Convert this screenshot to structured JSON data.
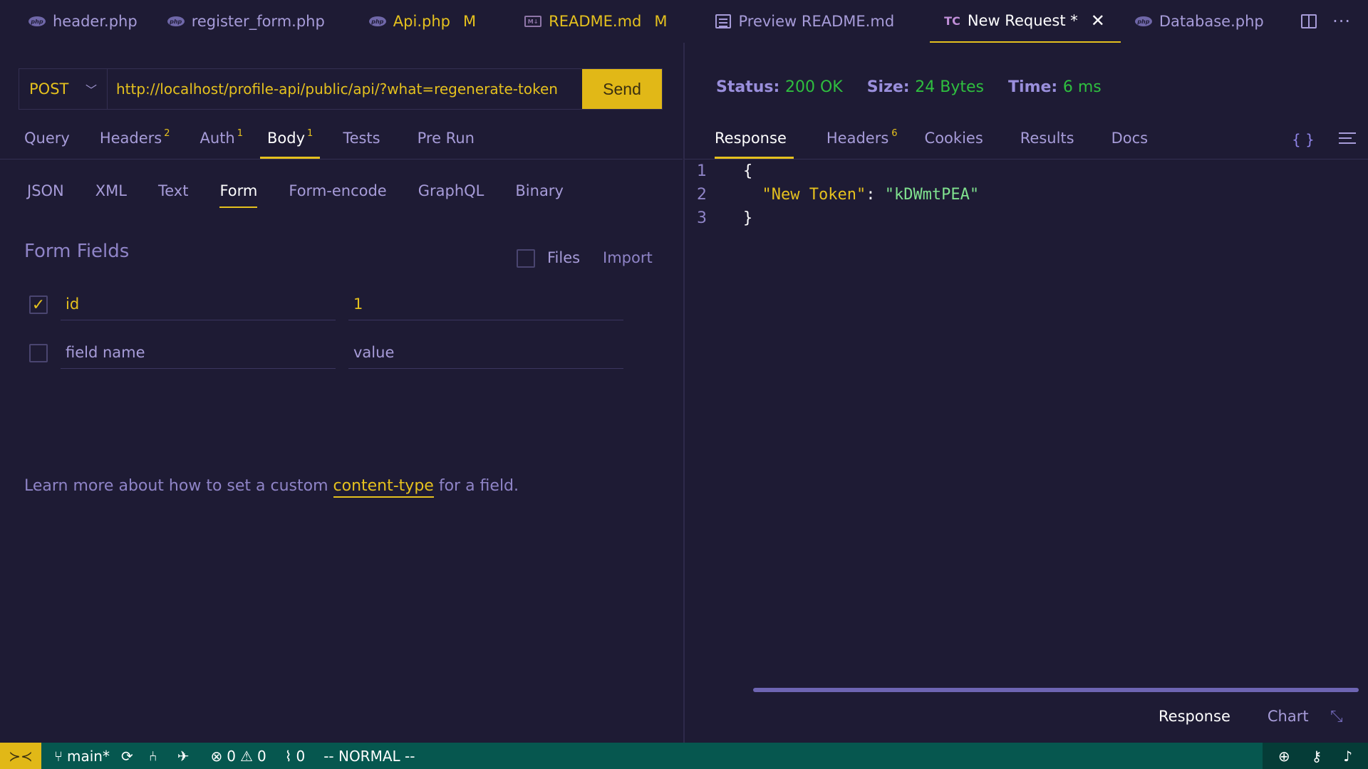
{
  "tabs": [
    {
      "label": "header.php",
      "icon": "php-file-icon",
      "modified": ""
    },
    {
      "label": "register_form.php",
      "icon": "php-file-icon",
      "modified": ""
    },
    {
      "label": "Api.php",
      "icon": "php-file-icon",
      "modified": "M"
    },
    {
      "label": "README.md",
      "icon": "markdown-file-icon",
      "modified": "M"
    },
    {
      "label": "Preview README.md",
      "icon": "preview-icon",
      "modified": ""
    },
    {
      "label": "New Request *",
      "icon": "thunder-client-icon",
      "icon_text": "TC",
      "modified": "",
      "active": true
    },
    {
      "label": "Database.php",
      "icon": "php-file-icon",
      "modified": ""
    }
  ],
  "request": {
    "method": "POST",
    "url": "http://localhost/profile-api/public/api/?what=regenerate-token",
    "send_label": "Send",
    "tabs": [
      {
        "label": "Query",
        "badge": ""
      },
      {
        "label": "Headers",
        "badge": "2"
      },
      {
        "label": "Auth",
        "badge": "1"
      },
      {
        "label": "Body",
        "badge": "1"
      },
      {
        "label": "Tests",
        "badge": ""
      },
      {
        "label": "Pre Run",
        "badge": ""
      }
    ],
    "body_tabs": [
      "JSON",
      "XML",
      "Text",
      "Form",
      "Form-encode",
      "GraphQL",
      "Binary"
    ],
    "form": {
      "title": "Form Fields",
      "files_label": "Files",
      "import_label": "Import",
      "rows": [
        {
          "checked": true,
          "name": "id",
          "value": "1"
        },
        {
          "checked": false,
          "name": "",
          "value": "",
          "name_placeholder": "field name",
          "value_placeholder": "value"
        }
      ]
    },
    "help": {
      "prefix": "Learn more about how to set a custom ",
      "link": "content-type",
      "suffix": " for a field."
    }
  },
  "response": {
    "status_key": "Status:",
    "status": "200 OK",
    "size_key": "Size:",
    "size": "24 Bytes",
    "time_key": "Time:",
    "time": "6 ms",
    "tabs": [
      {
        "label": "Response",
        "badge": ""
      },
      {
        "label": "Headers",
        "badge": "6"
      },
      {
        "label": "Cookies",
        "badge": ""
      },
      {
        "label": "Results",
        "badge": ""
      },
      {
        "label": "Docs",
        "badge": ""
      }
    ],
    "code_lines": [
      "1",
      "2",
      "3"
    ],
    "json_key": "\"New Token\"",
    "json_value": "\"kDWmtPEA\"",
    "bottom_tabs": [
      "Response",
      "Chart"
    ]
  },
  "statusbar": {
    "branch": "main*",
    "errors": "0",
    "warnings": "0",
    "ports": "0",
    "mode": "-- NORMAL --"
  },
  "colors": {
    "background": "#1e1b34",
    "accent": "#e5c11e",
    "status_ok": "#2fbf3f",
    "statusbar": "#06574f"
  }
}
